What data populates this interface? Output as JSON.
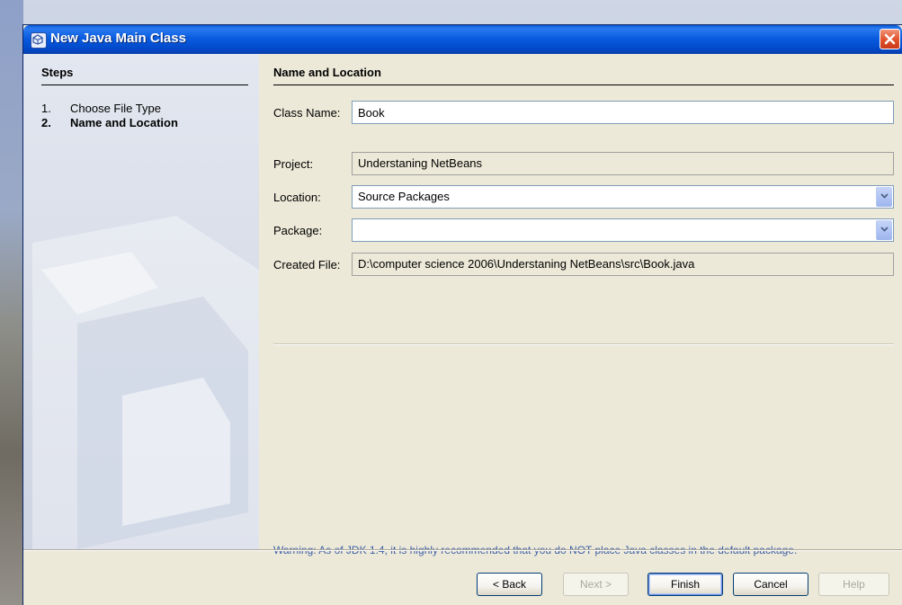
{
  "window": {
    "title": "New Java Main Class"
  },
  "steps": {
    "heading": "Steps",
    "items": [
      {
        "number": "1.",
        "label": "Choose File Type"
      },
      {
        "number": "2.",
        "label": "Name and Location"
      }
    ],
    "current_index": 1
  },
  "panel": {
    "title": "Name and Location",
    "class_name": {
      "label": "Class Name:",
      "value": "Book"
    },
    "project": {
      "label": "Project:",
      "value": "Understaning NetBeans"
    },
    "location": {
      "label": "Location:",
      "value": "Source Packages"
    },
    "package": {
      "label": "Package:",
      "value": ""
    },
    "created_file": {
      "label": "Created File:",
      "value": "D:\\computer science 2006\\Understaning NetBeans\\src\\Book.java"
    },
    "warning": "Warning: As of JDK 1.4, it is highly recommended that you do NOT place Java classes in the default package."
  },
  "buttons": {
    "back": "< Back",
    "next": "Next >",
    "finish": "Finish",
    "cancel": "Cancel",
    "help": "Help"
  },
  "colors": {
    "titlebar": "#0a5ce0",
    "warning_text": "#3c5fa8",
    "dialog_bg": "#ece9d8"
  }
}
